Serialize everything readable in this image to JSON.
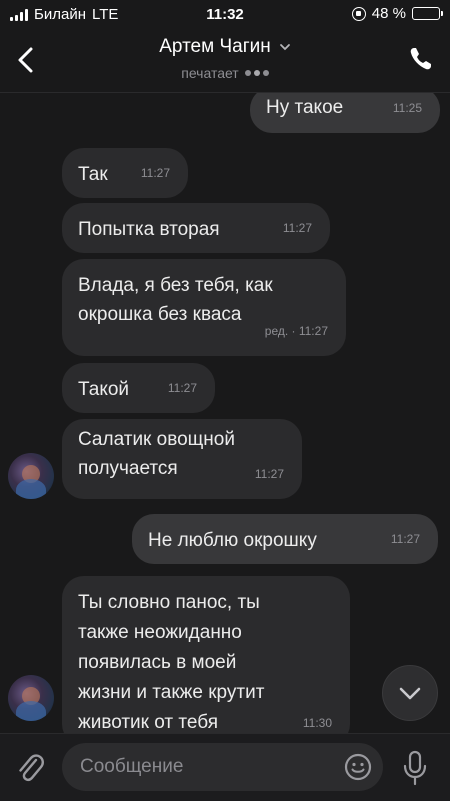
{
  "status_bar": {
    "carrier": "Билайн",
    "network": "LTE",
    "time": "11:32",
    "battery_text": "48 %",
    "battery_level": 0.48,
    "battery_color": "#f2c94c"
  },
  "header": {
    "contact_name": "Артем Чагин",
    "status": "печатает",
    "back_icon": "chevron-left-icon",
    "call_icon": "phone-icon"
  },
  "messages": [
    {
      "direction": "out",
      "text": "Ну такое",
      "time": "11:25"
    },
    {
      "direction": "in",
      "text": "Так",
      "time": "11:27"
    },
    {
      "direction": "in",
      "text": "Попытка вторая",
      "time": "11:27"
    },
    {
      "direction": "in",
      "text": "Влада, я без тебя, как\nокрошка без кваса",
      "time": "ред. · 11:27"
    },
    {
      "direction": "in",
      "text": "Такой",
      "time": "11:27"
    },
    {
      "direction": "in",
      "text": "Салатик овощной\nполучается",
      "time": "11:27"
    },
    {
      "direction": "out",
      "text": "Не люблю окрошку",
      "time": "11:27"
    },
    {
      "direction": "in",
      "text": "Ты словно панос, ты\nтакже неожиданно\nпоявилась в моей\nжизни и также крутит\nживотик от тебя",
      "time": "11:30"
    }
  ],
  "composer": {
    "placeholder": "Сообщение",
    "value": ""
  },
  "colors": {
    "background": "#19191a",
    "bubble_in": "#2b2b2d",
    "bubble_out": "#38383a"
  }
}
